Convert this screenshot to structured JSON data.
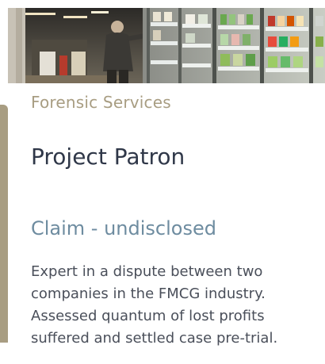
{
  "card": {
    "category": "Forensic Services",
    "title": "Project Patron",
    "subtitle": "Claim - undisclosed",
    "description": "Expert in a dispute between two companies in the FMCG industry. Assessed quantum of lost profits suffered and settled case pre-trial.",
    "hero_image": "supermarket-aisle-photo"
  },
  "colors": {
    "accent": "#a89d82",
    "title": "#2f3748",
    "subtitle": "#6e8ca0",
    "body": "#4a4f5a"
  }
}
